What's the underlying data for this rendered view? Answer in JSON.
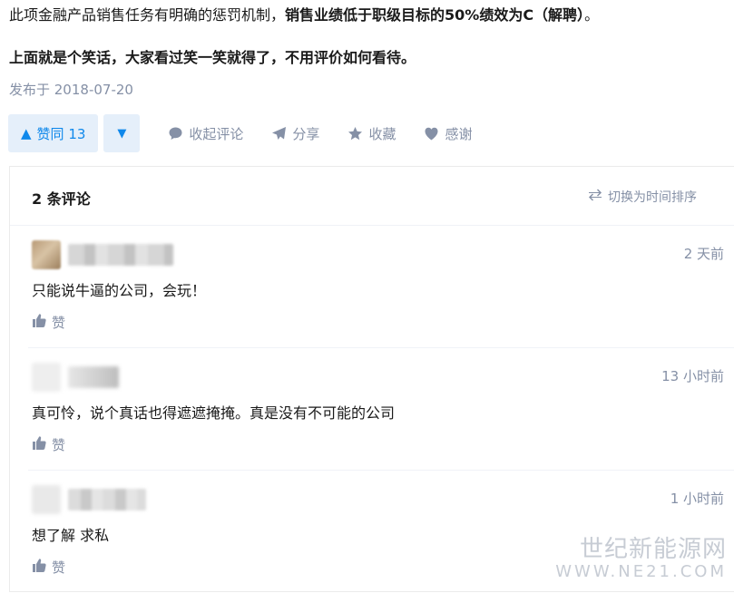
{
  "article": {
    "line1_normal": "此项金融产品销售任务有明确的惩罚机制，",
    "line1_bold": "销售业绩低于职级目标的50%绩效为C（解聘）",
    "line1_tail": "。",
    "line2": "上面就是个笑话，大家看过笑一笑就得了，不用评价如何看待。",
    "published": "发布于 2018-07-20"
  },
  "actions": {
    "vote_label": "赞同 13",
    "collapse_comments": "收起评论",
    "share": "分享",
    "favorite": "收藏",
    "thanks": "感谢"
  },
  "comments": {
    "count_label": "2 条评论",
    "sort_toggle": "切换为时间排序",
    "items": [
      {
        "time": "2 天前",
        "content": "只能说牛逼的公司，会玩！",
        "like_label": "赞"
      },
      {
        "time": "13 小时前",
        "content": "真可怜，说个真话也得遮遮掩掩。真是没有不可能的公司",
        "like_label": "赞"
      },
      {
        "time": "1 小时前",
        "content": "想了解 求私",
        "like_label": "赞"
      }
    ]
  },
  "watermark": {
    "line1": "世纪新能源网",
    "line2": "WWW.NE21.COM"
  },
  "colors": {
    "accent": "#0f88eb",
    "accent_bg": "#e5effa",
    "muted": "#8590a6",
    "divider": "#f0f2f7"
  }
}
